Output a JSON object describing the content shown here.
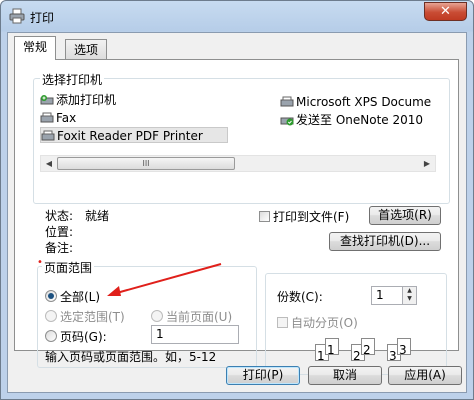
{
  "window": {
    "title": "打印",
    "close_label": "✕"
  },
  "tabs": [
    "常规",
    "选项"
  ],
  "select_printer": {
    "label": "选择打印机",
    "printers": [
      {
        "name": "添加打印机",
        "icon": "add-printer-icon"
      },
      {
        "name": "Fax",
        "icon": "fax-printer-icon"
      },
      {
        "name": "Foxit Reader PDF Printer",
        "icon": "printer-icon",
        "selected": true
      },
      {
        "name": "Microsoft XPS Docume",
        "icon": "printer-icon"
      },
      {
        "name": "发送至 OneNote 2010",
        "icon": "default-printer-icon"
      }
    ],
    "scroll_left": "◀",
    "scroll_right": "▶",
    "scroll_grip": "III"
  },
  "status": {
    "status_label": "状态:",
    "status_value": "就绪",
    "location_label": "位置:",
    "comment_label": "备注:",
    "print_to_file": "打印到文件(F)",
    "preferences_button": "首选项(R)",
    "find_printer_button": "查找打印机(D)..."
  },
  "page_range": {
    "label": "页面范围",
    "all": "全部(L)",
    "selection": "选定范围(T)",
    "current_page": "当前页面(U)",
    "pages": "页码(G):",
    "pages_value": "1",
    "hint": "输入页码或页面范围。如，5-12",
    "selected_option": "all"
  },
  "copies": {
    "label": "份数(C):",
    "value": "1",
    "collate": "自动分页(O)",
    "collate_pages": [
      "1",
      "1",
      "2",
      "2",
      "3",
      "3"
    ]
  },
  "buttons": {
    "print": "打印(P)",
    "cancel": "取消",
    "apply": "应用(A)"
  },
  "colors": {
    "annotation_arrow": "#e0201b",
    "title_bar": "#c7dbf0",
    "close_button": "#c94c34"
  }
}
